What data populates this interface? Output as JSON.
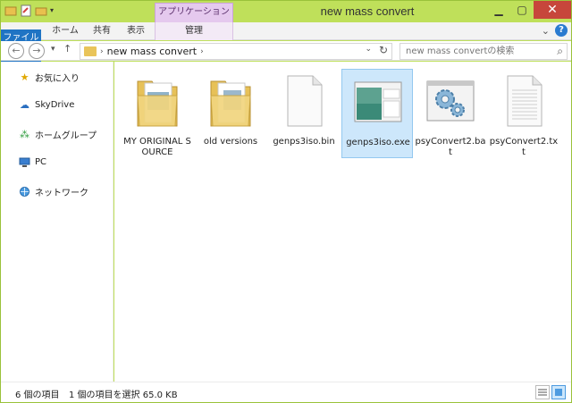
{
  "window": {
    "title": "new mass convert",
    "context_tab_group": "アプリケーション ツール"
  },
  "ribbon": {
    "tabs": [
      "ファイル",
      "ホーム",
      "共有",
      "表示",
      "管理"
    ]
  },
  "navigation": {
    "breadcrumb": "new mass convert",
    "search_placeholder": "new mass convertの検索"
  },
  "sidebar": {
    "items": [
      {
        "label": "お気に入り",
        "icon": "star-icon"
      },
      {
        "label": "SkyDrive",
        "icon": "cloud-icon"
      },
      {
        "label": "ホームグループ",
        "icon": "homegroup-icon"
      },
      {
        "label": "PC",
        "icon": "computer-icon"
      },
      {
        "label": "ネットワーク",
        "icon": "network-icon"
      }
    ]
  },
  "files": [
    {
      "name": "MY ORIGINAL SOURCE",
      "type": "folder"
    },
    {
      "name": "old versions",
      "type": "folder"
    },
    {
      "name": "genps3iso.bin",
      "type": "document"
    },
    {
      "name": "genps3iso.exe",
      "type": "application",
      "selected": true
    },
    {
      "name": "psyConvert2.bat",
      "type": "batch"
    },
    {
      "name": "psyConvert2.txt",
      "type": "text"
    }
  ],
  "status": {
    "item_count": "6 個の項目",
    "selection": "1 個の項目を選択  65.0 KB"
  },
  "colors": {
    "title_bar": "#bfe05a",
    "file_tab": "#1f74c4",
    "context_tab": "#e5c9ee",
    "selection": "#cde7fb"
  }
}
